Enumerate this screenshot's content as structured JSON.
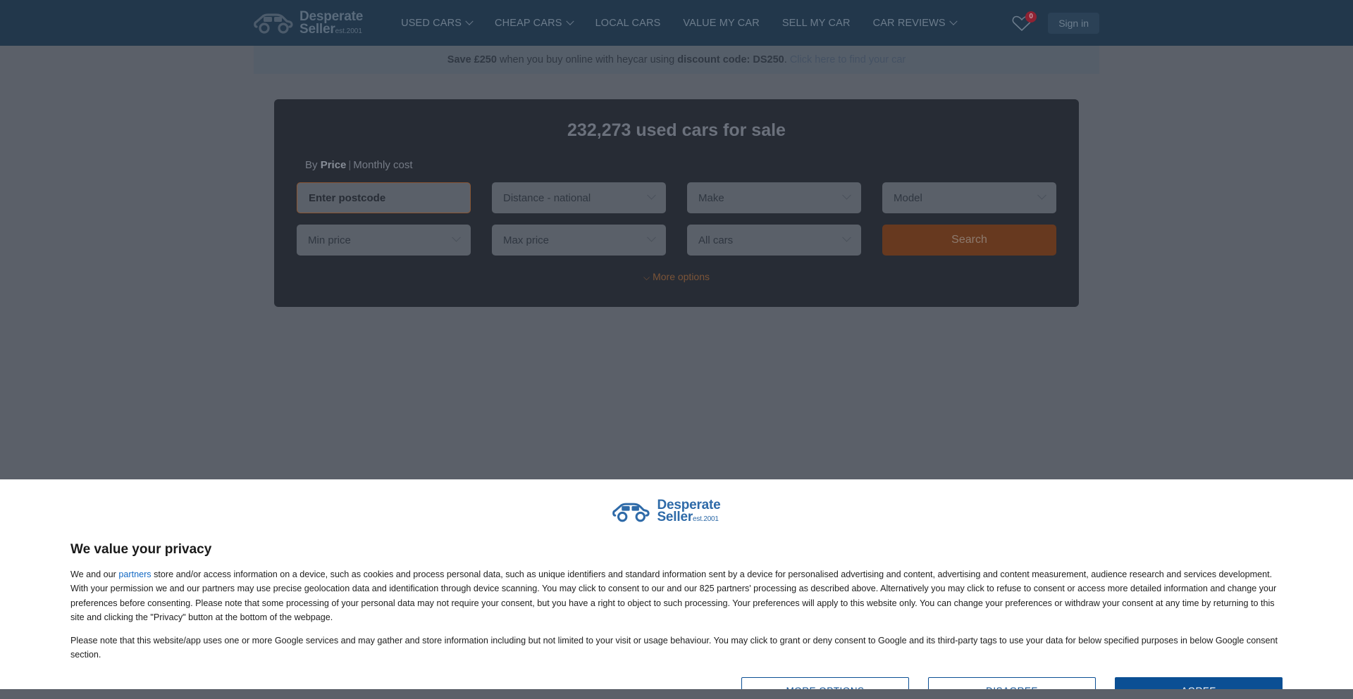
{
  "header": {
    "logo": {
      "line1": "Desperate",
      "line2": "Seller",
      "est": "est.2001",
      "icon": "car-icon"
    },
    "nav": [
      {
        "label": "USED CARS",
        "has_caret": true
      },
      {
        "label": "CHEAP CARS",
        "has_caret": true
      },
      {
        "label": "LOCAL CARS",
        "has_caret": false
      },
      {
        "label": "VALUE MY CAR",
        "has_caret": false
      },
      {
        "label": "SELL MY CAR",
        "has_caret": false
      },
      {
        "label": "CAR REVIEWS",
        "has_caret": true
      }
    ],
    "favourites": {
      "icon": "heart-icon",
      "count": "0",
      "badge_color": "#8e2233"
    },
    "sign_in": "Sign in"
  },
  "promo": {
    "bold_lead": "Save £250",
    "mid": " when you buy online with heycar using ",
    "bold_code": "discount code: DS250",
    "period": ". ",
    "link": "Click here to find your car"
  },
  "search_panel": {
    "title": "232,273 used cars for sale",
    "toggle": {
      "prefix": "By ",
      "active": "Price",
      "separator": "|",
      "alternate": "Monthly cost"
    },
    "fields": [
      {
        "name": "postcode",
        "value": "Enter postcode",
        "type": "input",
        "focused": true
      },
      {
        "name": "distance",
        "value": "Distance - national",
        "type": "select"
      },
      {
        "name": "make",
        "value": "Make",
        "type": "select"
      },
      {
        "name": "model",
        "value": "Model",
        "type": "select"
      },
      {
        "name": "min-price",
        "value": "Min price",
        "type": "select"
      },
      {
        "name": "max-price",
        "value": "Max price",
        "type": "select"
      },
      {
        "name": "all-cars",
        "value": "All cars",
        "type": "select"
      }
    ],
    "search_button": "Search",
    "more_options": "More options",
    "accent_color": "#67391f"
  },
  "consent": {
    "logo": {
      "line1": "Desperate",
      "line2": "Seller",
      "est": "est.2001",
      "icon": "car-icon"
    },
    "heading": "We value your privacy",
    "paragraph1_a": "We and our ",
    "paragraph1_link": "partners",
    "paragraph1_b": " store and/or access information on a device, such as cookies and process personal data, such as unique identifiers and standard information sent by a device for personalised advertising and content, advertising and content measurement, audience research and services development. With your permission we and our partners may use precise geolocation data and identification through device scanning. You may click to consent to our and our 825 partners' processing as described above. Alternatively you may click to refuse to consent or access more detailed information and change your preferences before consenting. Please note that some processing of your personal data may not require your consent, but you have a right to object to such processing. Your preferences will apply to this website only. You can change your preferences or withdraw your consent at any time by returning to this site and clicking the \"Privacy\" button at the bottom of the webpage.",
    "paragraph2": "Please note that this website/app uses one or more Google services and may gather and store information including but not limited to your visit or usage behaviour. You may click to grant or deny consent to Google and its third-party tags to use your data for below specified purposes in below Google consent section.",
    "buttons": {
      "more_options": "MORE OPTIONS",
      "disagree": "DISAGREE",
      "agree": "AGREE"
    },
    "primary_color": "#0b4f94"
  }
}
